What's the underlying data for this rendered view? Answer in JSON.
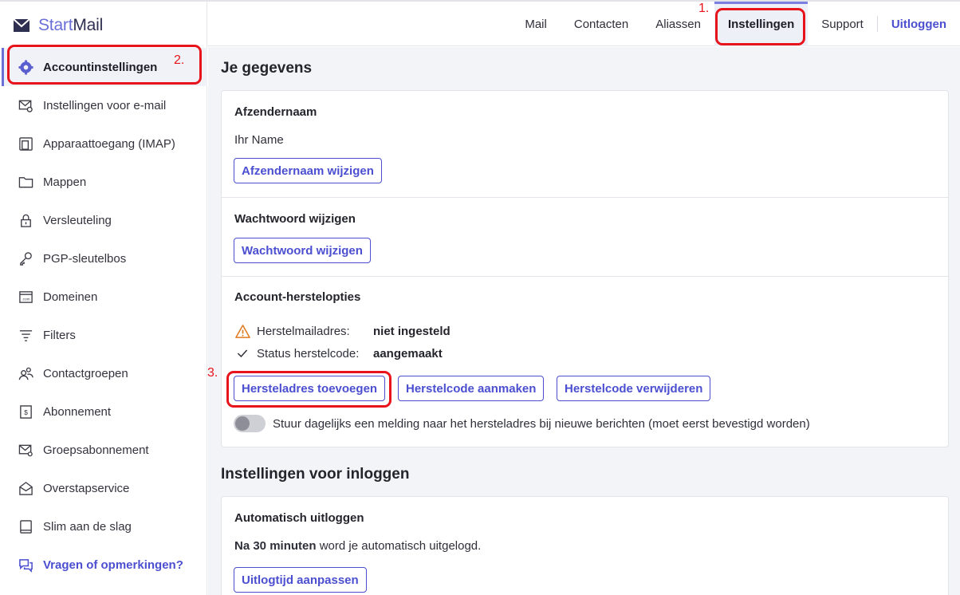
{
  "app": {
    "name_start": "Start",
    "name_mail": "Mail"
  },
  "topnav": {
    "tabs": [
      {
        "label": "Mail"
      },
      {
        "label": "Contacten"
      },
      {
        "label": "Aliassen"
      },
      {
        "label": "Instellingen"
      },
      {
        "label": "Support"
      }
    ],
    "logout": "Uitloggen"
  },
  "sidebar": {
    "items": [
      {
        "label": "Accountinstellingen",
        "icon": "gear-icon"
      },
      {
        "label": "Instellingen voor e-mail",
        "icon": "mail-settings-icon"
      },
      {
        "label": "Apparaattoegang (IMAP)",
        "icon": "device-icon"
      },
      {
        "label": "Mappen",
        "icon": "folder-icon"
      },
      {
        "label": "Versleuteling",
        "icon": "lock-icon"
      },
      {
        "label": "PGP-sleutelbos",
        "icon": "key-icon"
      },
      {
        "label": "Domeinen",
        "icon": "domain-icon"
      },
      {
        "label": "Filters",
        "icon": "filter-icon"
      },
      {
        "label": "Contactgroepen",
        "icon": "contact-groups-icon"
      },
      {
        "label": "Abonnement",
        "icon": "subscription-icon"
      },
      {
        "label": "Groepsabonnement",
        "icon": "group-subscription-icon"
      },
      {
        "label": "Overstapservice",
        "icon": "migration-icon"
      },
      {
        "label": "Slim aan de slag",
        "icon": "guide-icon"
      }
    ],
    "feedback": "Vragen of opmerkingen?"
  },
  "annotations": {
    "one": "1.",
    "two": "2.",
    "three": "3."
  },
  "main": {
    "section1_title": "Je gegevens",
    "sender": {
      "title": "Afzendernaam",
      "value": "Ihr Name",
      "button": "Afzendernaam wijzigen"
    },
    "password": {
      "title": "Wachtwoord wijzigen",
      "button": "Wachtwoord wijzigen"
    },
    "recovery": {
      "title": "Account-herstelopties",
      "email_label": "Herstelmailadres:",
      "email_value": "niet ingesteld",
      "code_label": "Status herstelcode:",
      "code_value": "aangemaakt",
      "btn_add": "Herstel­adres toevoegen",
      "btn_create": "Herstelcode aanmaken",
      "btn_delete": "Herstelcode verwijderen",
      "toggle_label": "Stuur dagelijks een melding naar het hersteladres bij nieuwe berichten (moet eerst bevestigd worden)",
      "toggle_on": false
    },
    "section2_title": "Instellingen voor inloggen",
    "autologout": {
      "title": "Automatisch uitloggen",
      "value_bold": "Na 30 minuten",
      "value_rest": " word je automatisch uitgelogd.",
      "button": "Uitlogtijd aanpassen"
    }
  },
  "colors": {
    "accent": "#4b4fd0",
    "annotation": "#e8141c",
    "warning": "#e07a1f"
  }
}
